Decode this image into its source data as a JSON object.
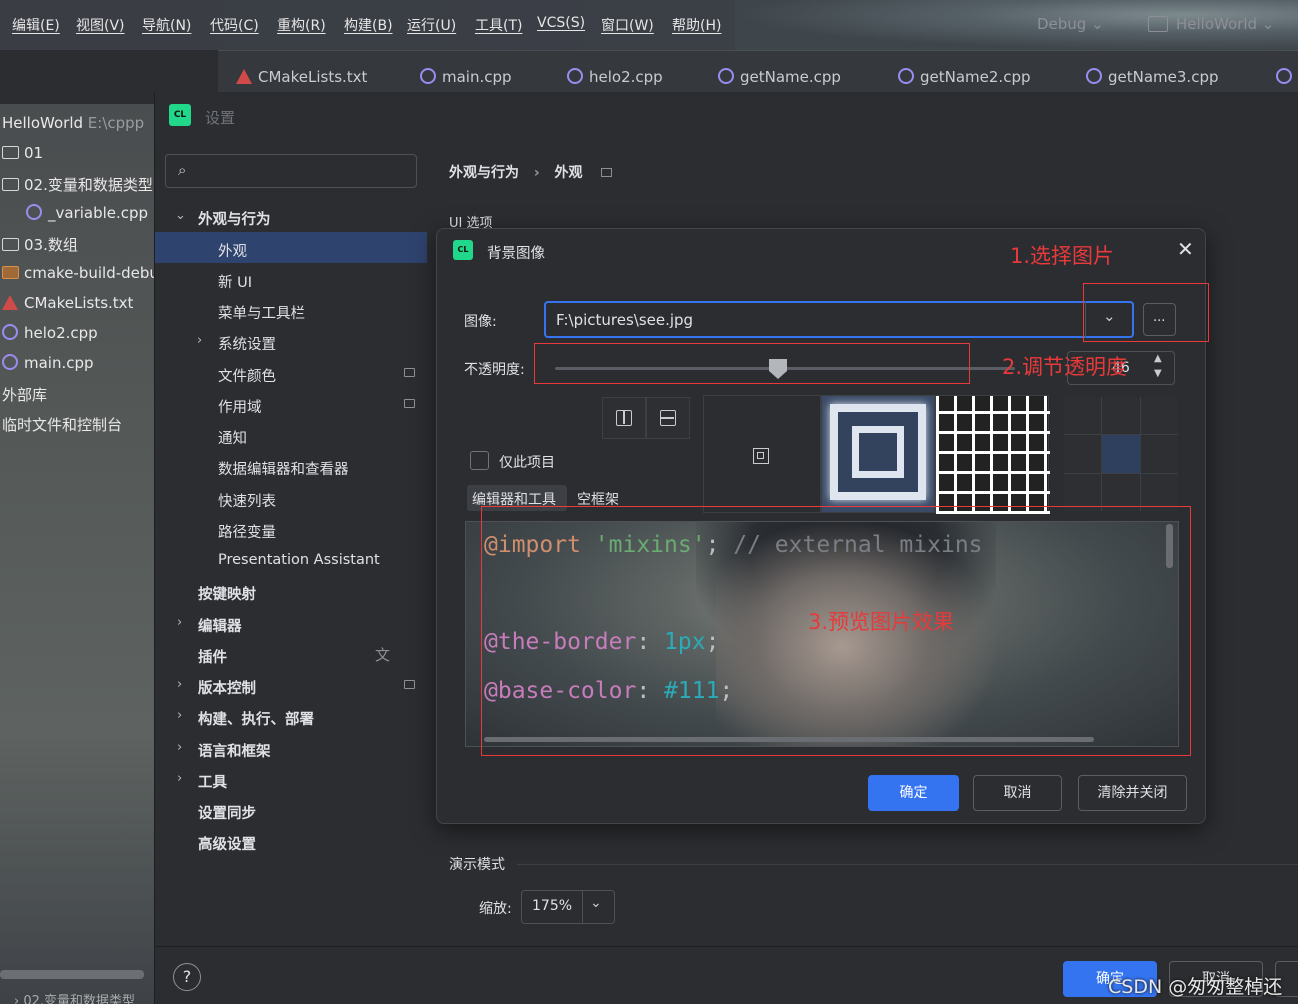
{
  "menu": [
    "编辑(E)",
    "视图(V)",
    "导航(N)",
    "代码(C)",
    "重构(R)",
    "构建(B)",
    "运行(U)",
    "工具(T)",
    "VCS(S)",
    "窗口(W)",
    "帮助(H)"
  ],
  "run_config": "Debug",
  "project_name": "HelloWorld",
  "tabs": [
    "CMakeLists.txt",
    "main.cpp",
    "helo2.cpp",
    "getName.cpp",
    "getName2.cpp",
    "getName3.cpp"
  ],
  "project_panel": {
    "root": "HelloWorld",
    "root_path": "E:\\cppp",
    "items": [
      "01",
      "02.变量和数据类型",
      "_variable.cpp",
      "03.数组",
      "cmake-build-debu",
      "CMakeLists.txt",
      "helo2.cpp",
      "main.cpp",
      "外部库",
      "临时文件和控制台"
    ],
    "bottom": "02.变量和数据类型"
  },
  "settings": {
    "title": "设置",
    "nav": {
      "appearance_behavior": "外观与行为",
      "appearance": "外观",
      "new_ui": "新 UI",
      "menus_toolbars": "菜单与工具栏",
      "system_settings": "系统设置",
      "file_colors": "文件颜色",
      "scopes": "作用域",
      "notifications": "通知",
      "data_editor": "数据编辑器和查看器",
      "quick_lists": "快速列表",
      "path_variables": "路径变量",
      "presentation_assistant": "Presentation Assistant",
      "keymap": "按键映射",
      "editor": "编辑器",
      "plugins": "插件",
      "vcs": "版本控制",
      "build": "构建、执行、部署",
      "languages": "语言和框架",
      "tools": "工具",
      "sync": "设置同步",
      "advanced": "高级设置"
    },
    "breadcrumb": [
      "外观与行为",
      "外观"
    ],
    "ui_options_label": "UI 选项",
    "presentation_mode": "演示模式",
    "zoom_label": "缩放:",
    "zoom_value": "175%",
    "ok": "确定",
    "cancel": "取消"
  },
  "dialog": {
    "title": "背景图像",
    "image_label": "图像:",
    "image_value": "F:\\pictures\\see.jpg",
    "browse": "...",
    "opacity_label": "不透明度:",
    "opacity_value": 46,
    "opacity_text": "46",
    "only_project": "仅此项目",
    "target_tabs": [
      "编辑器和工具",
      "空框架"
    ],
    "code_lines": [
      {
        "a": "@import",
        "b": " 'mixins'",
        "c": ";",
        "d": " // external mixins"
      },
      {
        "a": "@the-border",
        "b": ": ",
        "c": "1px",
        "d": ";"
      },
      {
        "a": "@base-color",
        "b": ": ",
        "c": "#111",
        "d": ";"
      }
    ],
    "ok": "确定",
    "cancel": "取消",
    "clear_close": "清除并关闭"
  },
  "annotations": [
    "1.选择图片",
    "2.调节透明度",
    "3.预览图片效果"
  ],
  "watermark": "CSDN @匆匆整棹还",
  "colors": {
    "accent": "#3574f0",
    "annotation": "#e8393b",
    "selection": "#2e436e"
  }
}
